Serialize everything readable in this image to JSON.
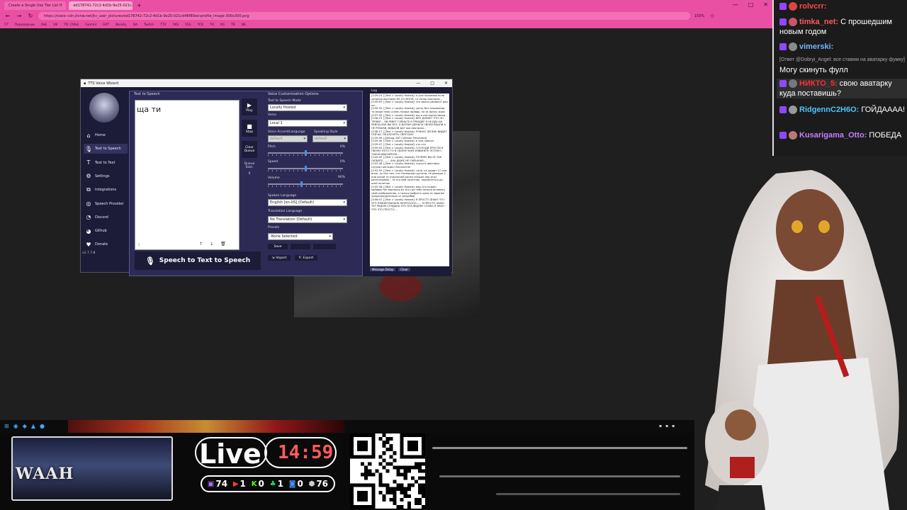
{
  "browser": {
    "tabs": [
      "Create a Single Use Tier List If",
      "ed178742-72c2-4d1b-9e25-021c..."
    ],
    "url": "https://static-cdn.jtvnw.net/jtv_user_pictures/ed178742-72c2-4d1b-9e25-021cd48f80ed-profile_image-300x300.png",
    "zoom": "150%",
    "bookmarks": [
      "YT",
      "Переводчик",
      "PoE",
      "VK",
      "TR: CMail",
      "Gemini",
      "GPT",
      "Boosty",
      "DA",
      "Twitch",
      "TTV",
      "YKS",
      "YES",
      "YCK",
      "TR",
      "KS",
      "TR",
      "NS"
    ]
  },
  "tts": {
    "title": "TTS Voice Wizard",
    "sidebar": [
      {
        "label": "Home",
        "icon": "home-icon"
      },
      {
        "label": "Text to Speech",
        "icon": "microphone-icon"
      },
      {
        "label": "Text to Text",
        "icon": "text-icon"
      },
      {
        "label": "Settings",
        "icon": "gear-icon"
      },
      {
        "label": "Integrations",
        "icon": "integrations-icon"
      },
      {
        "label": "Speech Provider",
        "icon": "speech-provider-icon"
      },
      {
        "label": "Discord",
        "icon": "discord-icon"
      },
      {
        "label": "Github",
        "icon": "github-icon"
      },
      {
        "label": "Donate",
        "icon": "donate-icon"
      }
    ],
    "version": "v1.7.7.8",
    "panel_label": "Text to Speech",
    "text_value": "ща ти",
    "char_count": "5",
    "buttons": {
      "play": "Play",
      "stop": "Stop",
      "clear": "Clear Queue",
      "queue_size_label": "Queue Size:",
      "queue_size": "0"
    },
    "stt_button": "Speech to Text to Speech",
    "voice_options": {
      "title": "Voice Customization Options",
      "mode_label": "Text to Speech Mode",
      "mode": "Locally Hosted",
      "voice_label": "Voice",
      "voice": "Local 1",
      "accent_label": "Voice Accent/Language",
      "accent": "default",
      "style_label": "Speaking Style",
      "style": "default",
      "pitch_label": "Pitch",
      "pitch": "0%",
      "speed_label": "Speed",
      "speed": "0%",
      "volume_label": "Volume",
      "volume": "96%",
      "spoken_label": "Spoken Language",
      "spoken": "English [en-US] (Default)",
      "translation_label": "Translation Language",
      "translation": "No Translation (Default)",
      "presets_label": "Presets",
      "presets": "-None Selected-",
      "save": "Save",
      "import": "Import",
      "export": "Export"
    },
    "sliders": {
      "pitch": 0.5,
      "speed": 0.5,
      "volume": 0.45
    },
    "log": {
      "title": "Log",
      "lines": [
        "[3:39:24 ] [Text > Locally Hosted]: я уже нажимаю если ланиная аватарка НЕ СО МНОЙ, то позор аватарок…",
        "[3:39:55 ] [Text > Locally Hosted]: это авоси рисовал? или не...",
        "[3:39:34 ] [Text > Locally Hosted]: жаль, без алхимиков, та везде плюс очень позора правда, на за фулку жаль",
        "[3:37:49 ] [Text > Locally Hosted]: ещ и настрасосником...",
        "[3:38:15 ] [Text > Locally Hosted]: ВРО ДУМАЕТ ЧТО ОН ТРЕВЕР... ЭЙ РЕВЕТ ГЛЯНЬТЕ Я ТРЕЙДЕР Я НЕ ВДУ НА ЗАВОД КАК ВЫ ВСЕ, Я ДЕЛАЮ ДЕНЬГИ СВОЕЙ ВАДОЙ А НЕ РУКАМИ, ВИДАЛИ ДА? аха аватарка...",
        "[3:38:17 ] [Text > Locally Hosted]: РОЖНО ЛИ ВНЕ ВИДИТ СЕЙЧАС ОБЪЯСНЯТЬ СВЯТНОЮ",
        "[3:39:49 ] [Debug: KAT Collision Prevented]",
        "[3:39:46 ] [Text > Locally Hosted]: в чем прикол",
        "[3:39:47 ] [Text > Locally Hosted]: кто это",
        "[3:39:55 ] [Text > Locally Hosted]: ГОСПОДИ ПРОСТИ Я ОБНУЮ КОГО ТО В СВОЕМ ЧАНЕ ИЗВИНЕТЕ ПОТОМ С ТАКОЙ АВАТАРКОЙ...",
        "[3:44:45 ] [Text > Locally Hosted]: ПОЧЕМУ ВЫ ЕЕ ТАК ЛЮБИТЕ........ ОНА ДАЖЕ НЕ СМЕШНАЯ....",
        "[3:52:36 ] [Text > Locally Hosted]: скачать аватарку сусума пинтерест бесплатно",
        "[3:52:55 ] [Text > Locally Hosted]: типо, но щадит 17 или игры, ну как там, это телевизор крутили, не дважды 2 или какой то отдельный канал похоже про игру рассказываю... за это мой почетник, подписаться до осей полегаю",
        "[3:55:38 ] [Text > Locally Hosted]: ваш это отдает кайфом так аватарка из игр где тебе нельзя оставить свой изображения, а только выбрать одно из заранее предопределенных от разрабов",
        "[3:56:07 ] [Text > Locally Hosted]: Я ПРОСТО ЗНАЮ ЧТО ЭТО ЛЯЖКИ ВАНАНА НЕУРОСОЛО...... Я ПРОСТО ЗНАЮ ТУТ РЯДОМ СОЗДАНА ЭТО ПОСЛЕДНЕЕ СЛОВО Я ЗНАЛ ЧТО ЭТО ПРОСТО..."
      ],
      "footer": [
        "Message Delay",
        "Clear"
      ]
    }
  },
  "chat": {
    "messages": [
      {
        "user": "rolvcrr:",
        "text": "",
        "user_color": "#ff4a4a"
      },
      {
        "user": "timka_net:",
        "text": " С прошедшим новым годом",
        "user_color": "#ff5a5a"
      },
      {
        "user": "vimerski:",
        "text": "",
        "user_color": "#6fb6ff"
      },
      {
        "reply": "[Ответ @Dobryi_Angel: все ставим на аватарку фумку]",
        "text": "Могу скинуть фулл"
      },
      {
        "user": "НИКТО_5:",
        "text": " свою аватарку куда поставишь?",
        "user_color": "#ff3030"
      },
      {
        "user": "RidgennC2H6O:",
        "text": " ГОЙДАААА!",
        "user_color": "#4fc3f7"
      },
      {
        "user": "Kusarigama_Otto:",
        "text": " ПОБЕДА",
        "user_color": "#c77dff"
      }
    ]
  },
  "overlay": {
    "webcam_label": "WAAH",
    "live": "Live",
    "time": "14:59",
    "stats": [
      {
        "icon": "twitch-icon",
        "value": "74"
      },
      {
        "icon": "youtube-icon",
        "value": "1"
      },
      {
        "icon": "kick-icon",
        "value": "0"
      },
      {
        "icon": "trovo-icon",
        "value": "1"
      },
      {
        "icon": "vk-live-icon",
        "value": "0"
      },
      {
        "icon": "other-platform-icon",
        "value": "76"
      }
    ]
  },
  "colors": {
    "accent": "#e94fa3",
    "tts_bg": "#2d2b55",
    "tts_dark": "#1c1b38",
    "timer": "#ff5b5b"
  }
}
